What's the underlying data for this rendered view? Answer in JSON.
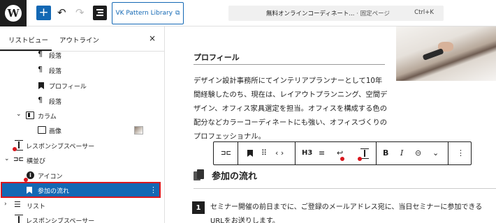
{
  "topbar": {
    "vk_label": "VK Pattern Library",
    "doc_title": "無料オンラインコーディネート...",
    "doc_type": "· 固定ページ",
    "shortcut": "Ctrl+K"
  },
  "left_panel": {
    "tab_list": "リストビュー",
    "tab_outline": "アウトライン",
    "close": "×",
    "rows": {
      "r0": "段落",
      "r1": "段落",
      "r2": "プロフィール",
      "r3": "段落",
      "r4": "カラム",
      "r5": "画像",
      "r6": "レスポンシブスペーサー",
      "r7": "横並び",
      "r8": "アイコン",
      "r9": "参加の流れ",
      "r10": "リスト",
      "r11": "レスポンシブスペーサー"
    }
  },
  "canvas": {
    "heading": "プロフィール",
    "paragraph": "デザイン設計事務所にてインテリアプランナーとして10年間経験したのち、現在は、レイアウトプランニング、空間デザイン、オフィス家具選定を担当。オフィスを構成する色の配分などカラーコーディネートにも強い、オフィスづくりのプロフェッショナル。",
    "toolbar": {
      "h3": "H3",
      "bold": "B",
      "italic": "I"
    },
    "section_title": "参加の流れ",
    "step_number": "1",
    "step_text": "セミナー開催の前日までに、ご登録のメールアドレス宛に、当日セミナーに参加できるURLをお送りします。"
  },
  "colors": {
    "accent": "#1368b4",
    "highlight_border": "#d9171e",
    "dark": "#1e1e1e"
  }
}
